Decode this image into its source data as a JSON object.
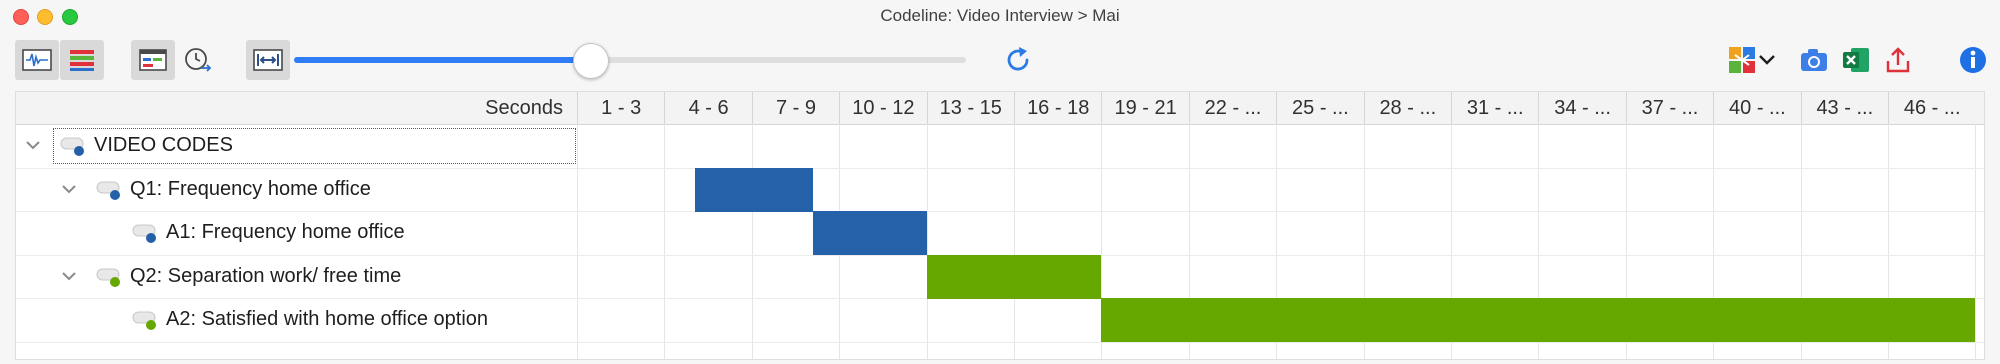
{
  "window": {
    "title": "Codeline: Video Interview > Mai"
  },
  "toolbar": {
    "buttons": [
      {
        "icon": "waveform-icon",
        "selected": true
      },
      {
        "icon": "colored-bars-icon",
        "selected": true
      },
      {
        "icon": "layout-icon",
        "selected": true
      },
      {
        "icon": "clock-sync-icon",
        "selected": false
      },
      {
        "icon": "fit-width-icon",
        "selected": true
      }
    ],
    "zoom_level": 0.44,
    "right_buttons": [
      "refresh-icon",
      "color-codes-menu-icon",
      "camera-icon",
      "excel-export-icon",
      "share-export-icon",
      "info-icon"
    ]
  },
  "table": {
    "header_first": "Seconds",
    "columns": [
      "1 - 3",
      "4 - 6",
      "7 - 9",
      "10 - 12",
      "13 - 15",
      "16 - 18",
      "19 - 21",
      "22 - ...",
      "25 - ...",
      "28 - ...",
      "31 - ...",
      "34 - ...",
      "37 - ...",
      "40 - ...",
      "43 - ...",
      "46 - ..."
    ],
    "rows": [
      {
        "label": "VIDEO CODES",
        "level": 0,
        "expandable": true,
        "dot_color": "#2460a8"
      },
      {
        "label": "Q1: Frequency home office",
        "level": 1,
        "expandable": true,
        "dot_color": "#2460a8"
      },
      {
        "label": "A1: Frequency home office",
        "level": 2,
        "expandable": false,
        "dot_color": "#2460a8"
      },
      {
        "label": "Q2: Separation work/ free time",
        "level": 1,
        "expandable": true,
        "dot_color": "#66a800"
      },
      {
        "label": "A2: Satisfied with home office option",
        "level": 2,
        "expandable": false,
        "dot_color": "#66a800"
      }
    ],
    "segments": [
      {
        "row": 1,
        "start_col": 1.35,
        "end_col": 2.7,
        "color": "#2461a8"
      },
      {
        "row": 2,
        "start_col": 2.7,
        "end_col": 4.0,
        "color": "#2461a8"
      },
      {
        "row": 3,
        "start_col": 4.0,
        "end_col": 6.0,
        "color": "#66a800"
      },
      {
        "row": 4,
        "start_col": 6.0,
        "end_col": 16.0,
        "color": "#66a800"
      }
    ]
  }
}
